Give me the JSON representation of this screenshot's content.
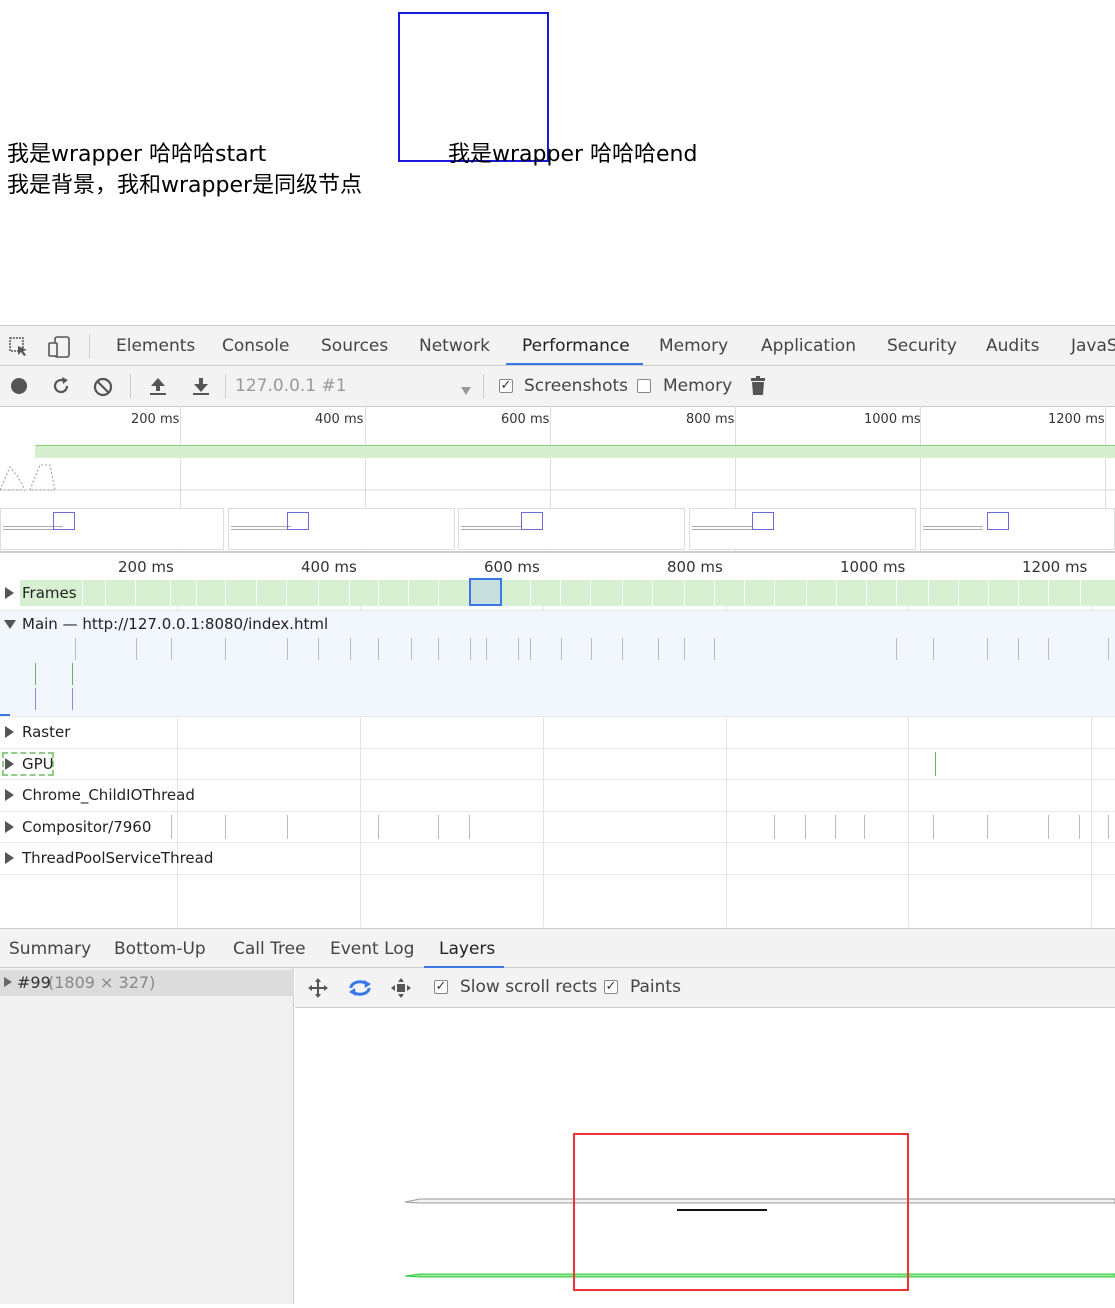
{
  "page": {
    "line1_start": "我是wrapper 哈哈哈start",
    "line1_end": "我是wrapper 哈哈哈end",
    "line2": "我是背景，我和wrapper是同级节点"
  },
  "devtools": {
    "tabs": [
      "Elements",
      "Console",
      "Sources",
      "Network",
      "Performance",
      "Memory",
      "Application",
      "Security",
      "Audits",
      "JavaS"
    ],
    "active_tab": "Performance",
    "toolbar": {
      "target": "127.0.0.1 #1",
      "screenshots_label": "Screenshots",
      "screenshots_checked": true,
      "memory_label": "Memory",
      "memory_checked": false
    },
    "overview_ticks": [
      "200 ms",
      "400 ms",
      "600 ms",
      "800 ms",
      "1000 ms",
      "1200 ms"
    ],
    "ruler_ticks": [
      "200 ms",
      "400 ms",
      "600 ms",
      "800 ms",
      "1000 ms",
      "1200 ms"
    ],
    "tracks": {
      "frames": "Frames",
      "main": "Main — http://127.0.0.1:8080/index.html",
      "raster": "Raster",
      "gpu": "GPU",
      "childio": "Chrome_ChildIOThread",
      "compositor": "Compositor/7960",
      "threadpool": "ThreadPoolServiceThread"
    },
    "details_tabs": [
      "Summary",
      "Bottom-Up",
      "Call Tree",
      "Event Log",
      "Layers"
    ],
    "active_details_tab": "Layers",
    "layer_tree": {
      "id": "#99",
      "size": "(1809 × 327)"
    },
    "layers_toolbar": {
      "slow_scroll_label": "Slow scroll rects",
      "slow_scroll_checked": true,
      "paints_label": "Paints",
      "paints_checked": true
    },
    "colors": {
      "accent": "#3b78e7",
      "frames_green": "#d7f0d1",
      "highlight_red": "#e33333",
      "wrapper_blue": "#1a1adf"
    }
  }
}
